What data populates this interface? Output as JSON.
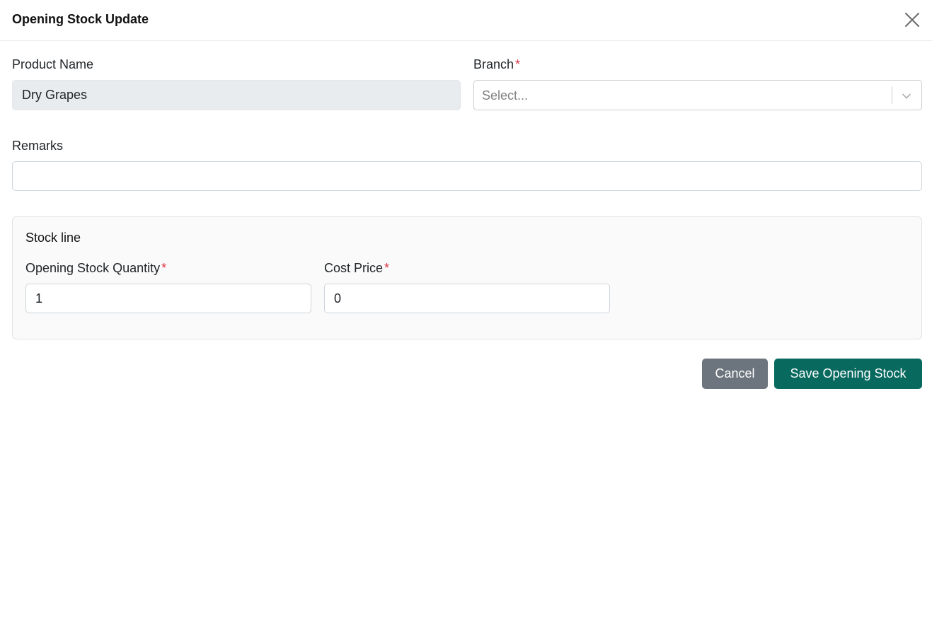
{
  "modal": {
    "title": "Opening Stock Update"
  },
  "form": {
    "product_name_label": "Product Name",
    "product_name_value": "Dry Grapes",
    "branch_label": "Branch",
    "branch_placeholder": "Select...",
    "remarks_label": "Remarks",
    "remarks_value": "",
    "required_marker": "*"
  },
  "stock_line": {
    "title": "Stock line",
    "quantity_label": "Opening Stock Quantity",
    "quantity_value": "1",
    "cost_price_label": "Cost Price",
    "cost_price_value": "0"
  },
  "actions": {
    "cancel_label": "Cancel",
    "save_label": "Save Opening Stock"
  },
  "colors": {
    "primary": "#08695f",
    "secondary": "#6c757d",
    "required": "#dc3545",
    "readonly_bg": "#e9ecef"
  },
  "icons": {
    "close": "close-icon",
    "dropdown": "chevron-down-icon"
  }
}
